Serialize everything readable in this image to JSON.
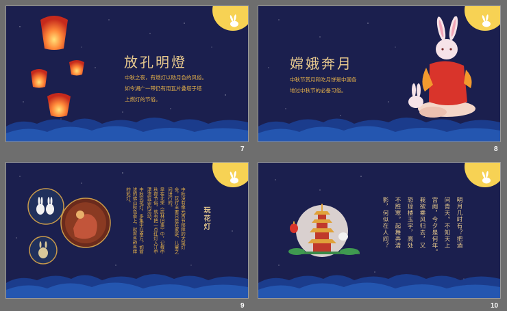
{
  "slides": [
    {
      "number": "7",
      "title": "放孔明燈",
      "lines": [
        "中秋之夜，有燃灯以助月色的风俗。",
        "如今湖广一带仍有用瓦片叠塔于塔",
        "上燃灯的节俗。"
      ]
    },
    {
      "number": "8",
      "title": "嫦娥奔月",
      "lines": [
        "中秋节赏月和吃月饼是中国各",
        "地过中秋节的必备习俗。"
      ]
    },
    {
      "number": "9",
      "title": "玩花灯",
      "columns": [
        "中秋没有像元宵节那样的大型灯会，玩灯主要只是在家庭、儿童之间进行的。",
        "早在北宋《武林旧事》中，记载中秋夜节俗，就有把一点红灯入江中漂流玩耍的活动。",
        "中秋玩花灯，多集中在南方。如前述的佛山秋色会上，就有各种各样的彩灯。"
      ]
    },
    {
      "number": "10",
      "columns": [
        "明月几时有？把酒",
        "问青天。不知天上",
        "宫阙，今夕是何年。",
        "我欲乘风归去，又",
        "恐琼楼玉宇，高处",
        "不胜寒。起舞弄清",
        "影，何似在人间？"
      ]
    }
  ],
  "colors": {
    "background": "#1b1f4e",
    "gold": "#e6c88d",
    "orange_text": "#e6b24a",
    "hill_dark": "#1b3c8c",
    "hill_light": "#2456b0",
    "moon": "#f7d254"
  }
}
